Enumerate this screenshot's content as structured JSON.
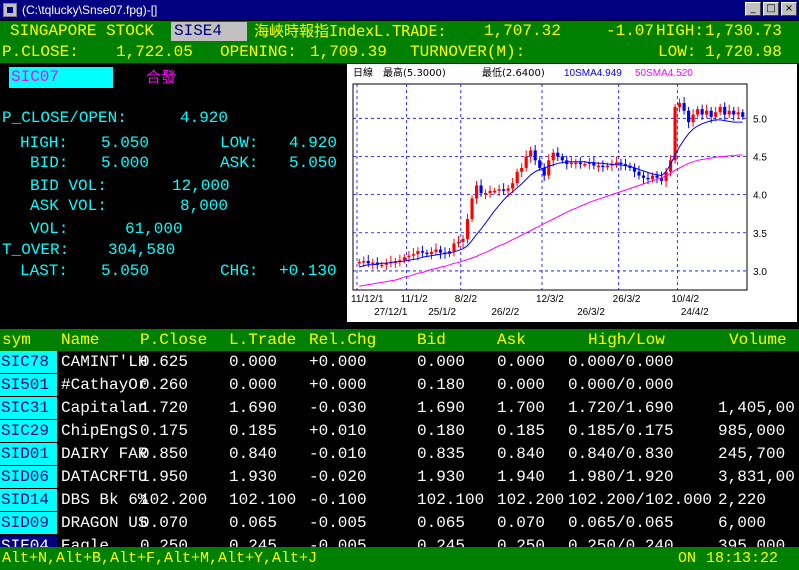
{
  "window": {
    "title": "(C:\\tqlucky\\Snse07.fpg)-[]"
  },
  "header": {
    "market": "SINGAPORE STOCK",
    "board": "SISE4",
    "index_label": "海峽時報指IndexL.TRADE:",
    "index_value": "1,707.32",
    "change": "-1.07",
    "high_label": "HIGH:",
    "high_value": "1,730.73",
    "pclose_label": "P.CLOSE:",
    "pclose_value": "1,722.05",
    "opening_label": "OPENING:",
    "opening_value": "1,709.39",
    "turnover_label": "TURNOVER(M):",
    "low_label": "LOW:",
    "low_value": "1,720.98"
  },
  "stock": {
    "code": "SIC07",
    "name": "合發",
    "pclose_open_label": "P_CLOSE/OPEN:",
    "pclose_open_value": "4.920",
    "high_label": "HIGH:",
    "high_value": "5.050",
    "low_label": "LOW:",
    "low_value": "4.920",
    "bid_label": "BID:",
    "bid_value": "5.000",
    "ask_label": "ASK:",
    "ask_value": "5.050",
    "bid_vol_label": "BID VOL:",
    "bid_vol_value": "12,000",
    "ask_vol_label": "ASK VOL:",
    "ask_vol_value": "8,000",
    "vol_label": "VOL:",
    "vol_value": "61,000",
    "tover_label": "T_OVER:",
    "tover_value": "304,580",
    "last_label": "LAST:",
    "last_value": "5.050",
    "chg_label": "CHG:",
    "chg_value": "+0.130"
  },
  "chart_data": {
    "type": "candlestick",
    "legend": {
      "period": "日線",
      "high_label": "最高(5.3000)",
      "low_label": "最低(2.6400)",
      "sma10": "10SMA4.949",
      "sma50": "50SMA4.520"
    },
    "ylim": [
      2.75,
      5.45
    ],
    "y_ticks": [
      "5.0",
      "4.5",
      "4.0",
      "3.5",
      "3.0"
    ],
    "y_tick_values": [
      5.0,
      4.5,
      4.0,
      3.5,
      3.0
    ],
    "x_labels_top": [
      "11/12/1",
      "11/1/2",
      "8/2/2",
      "12/3/2",
      "26/3/2",
      "10/4/2"
    ],
    "x_labels_bottom": [
      "27/12/1",
      "25/1/2",
      "26/2/2",
      "26/3/2",
      "24/4/2"
    ],
    "closes": [
      3.12,
      3.13,
      3.1,
      3.11,
      3.08,
      3.08,
      3.1,
      3.12,
      3.12,
      3.14,
      3.18,
      3.2,
      3.22,
      3.26,
      3.24,
      3.22,
      3.25,
      3.28,
      3.24,
      3.22,
      3.26,
      3.36,
      3.38,
      3.42,
      3.68,
      3.95,
      4.12,
      4.02,
      4.02,
      4.05,
      4.05,
      4.07,
      4.05,
      4.08,
      4.15,
      4.3,
      4.35,
      4.5,
      4.58,
      4.45,
      4.35,
      4.25,
      4.45,
      4.55,
      4.5,
      4.45,
      4.4,
      4.42,
      4.42,
      4.4,
      4.4,
      4.42,
      4.38,
      4.38,
      4.36,
      4.38,
      4.4,
      4.42,
      4.4,
      4.38,
      4.35,
      4.3,
      4.25,
      4.22,
      4.2,
      4.25,
      4.22,
      4.18,
      4.3,
      4.45,
      5.15,
      5.2,
      5.1,
      4.95,
      5.05,
      5.12,
      5.05,
      5.1,
      5.02,
      5.08,
      5.15,
      5.05,
      5.1,
      5.05,
      5.08,
      5.02
    ],
    "sma10": [
      3.05,
      3.07,
      3.08,
      3.08,
      3.09,
      3.1,
      3.1,
      3.11,
      3.12,
      3.12,
      3.13,
      3.14,
      3.15,
      3.16,
      3.18,
      3.19,
      3.2,
      3.21,
      3.22,
      3.23,
      3.24,
      3.25,
      3.27,
      3.29,
      3.33,
      3.4,
      3.48,
      3.55,
      3.63,
      3.71,
      3.79,
      3.86,
      3.93,
      3.99,
      4.04,
      4.09,
      4.14,
      4.2,
      4.26,
      4.3,
      4.33,
      4.35,
      4.37,
      4.39,
      4.41,
      4.42,
      4.43,
      4.43,
      4.43,
      4.43,
      4.43,
      4.42,
      4.42,
      4.41,
      4.41,
      4.4,
      4.4,
      4.39,
      4.39,
      4.38,
      4.37,
      4.35,
      4.33,
      4.31,
      4.29,
      4.27,
      4.26,
      4.25,
      4.3,
      4.4,
      4.52,
      4.63,
      4.72,
      4.8,
      4.86,
      4.9,
      4.93,
      4.95,
      4.97,
      4.98,
      4.98,
      4.97,
      4.96,
      4.95,
      4.95,
      4.95
    ],
    "sma50": [
      2.8,
      2.81,
      2.82,
      2.83,
      2.84,
      2.85,
      2.86,
      2.87,
      2.88,
      2.9,
      2.92,
      2.93,
      2.95,
      2.97,
      2.98,
      3.0,
      3.02,
      3.03,
      3.05,
      3.06,
      3.08,
      3.1,
      3.11,
      3.13,
      3.15,
      3.17,
      3.19,
      3.22,
      3.24,
      3.27,
      3.3,
      3.33,
      3.35,
      3.38,
      3.41,
      3.44,
      3.47,
      3.5,
      3.53,
      3.56,
      3.59,
      3.62,
      3.65,
      3.68,
      3.71,
      3.74,
      3.77,
      3.8,
      3.82,
      3.85,
      3.87,
      3.9,
      3.92,
      3.94,
      3.96,
      3.98,
      4.0,
      4.02,
      4.04,
      4.06,
      4.08,
      4.1,
      4.12,
      4.14,
      4.16,
      4.18,
      4.2,
      4.22,
      4.25,
      4.28,
      4.32,
      4.35,
      4.38,
      4.41,
      4.43,
      4.45,
      4.46,
      4.47,
      4.48,
      4.49,
      4.5,
      4.5,
      4.51,
      4.51,
      4.52,
      4.52
    ],
    "colors": {
      "up": "#ff0000",
      "down": "#0000ff",
      "sma10": "#0000ff",
      "sma50": "#ff00ff",
      "grid": "#0000ff"
    }
  },
  "table": {
    "headers": {
      "sym": "sym",
      "name": "Name",
      "pclose": "P.Close",
      "ltrade": "L.Trade",
      "relchg": "Rel.Chg",
      "bid": "Bid",
      "ask": "Ask",
      "highlow": "High/Low",
      "volume": "Volume"
    },
    "rows": [
      {
        "sym": "SIC78",
        "name": "CAMINT'LH",
        "pclose": "0.625",
        "ltrade": "0.000",
        "relchg": "+0.000",
        "bid": "0.000",
        "ask": "0.000",
        "highlow": "0.000/0.000",
        "volume": ""
      },
      {
        "sym": "SI501",
        "name": "#CathayOr",
        "pclose": "0.260",
        "ltrade": "0.000",
        "relchg": "+0.000",
        "bid": "0.180",
        "ask": "0.000",
        "highlow": "0.000/0.000",
        "volume": ""
      },
      {
        "sym": "SIC31",
        "name": "Capitalan",
        "pclose": "1.720",
        "ltrade": "1.690",
        "relchg": "-0.030",
        "bid": "1.690",
        "ask": "1.700",
        "highlow": "1.720/1.690",
        "volume": "1,405,00"
      },
      {
        "sym": "SIC29",
        "name": "ChipEngS",
        "pclose": "0.175",
        "ltrade": "0.185",
        "relchg": "+0.010",
        "bid": "0.180",
        "ask": "0.185",
        "highlow": "0.185/0.175",
        "volume": "985,000"
      },
      {
        "sym": "SID01",
        "name": "DAIRY FAR",
        "pclose": "0.850",
        "ltrade": "0.840",
        "relchg": "-0.010",
        "bid": "0.835",
        "ask": "0.840",
        "highlow": "0.840/0.830",
        "volume": "245,700"
      },
      {
        "sym": "SID06",
        "name": "DATACRFTU",
        "pclose": "1.950",
        "ltrade": "1.930",
        "relchg": "-0.020",
        "bid": "1.930",
        "ask": "1.940",
        "highlow": "1.980/1.920",
        "volume": "3,831,00"
      },
      {
        "sym": "SID14",
        "name": "DBS Bk 6%",
        "pclose": "102.200",
        "ltrade": "102.100",
        "relchg": "-0.100",
        "bid": "102.100",
        "ask": "102.200",
        "highlow": "102.200/102.000",
        "volume": "2,220"
      },
      {
        "sym": "SID09",
        "name": "DRAGON US",
        "pclose": "0.070",
        "ltrade": "0.065",
        "relchg": "-0.005",
        "bid": "0.065",
        "ask": "0.070",
        "highlow": "0.065/0.065",
        "volume": "6,000"
      },
      {
        "sym": "SIE04",
        "name": "Eagle",
        "pclose": "0.250",
        "ltrade": "0.245",
        "relchg": "-0.005",
        "bid": "0.245",
        "ask": "0.250",
        "highlow": "0.250/0.240",
        "volume": "395,000"
      }
    ]
  },
  "status": {
    "shortcuts": "Alt+N,Alt+B,Alt+F,Alt+M,Alt+Y,Alt+J",
    "connection": "ON",
    "time": "18:13:22"
  }
}
